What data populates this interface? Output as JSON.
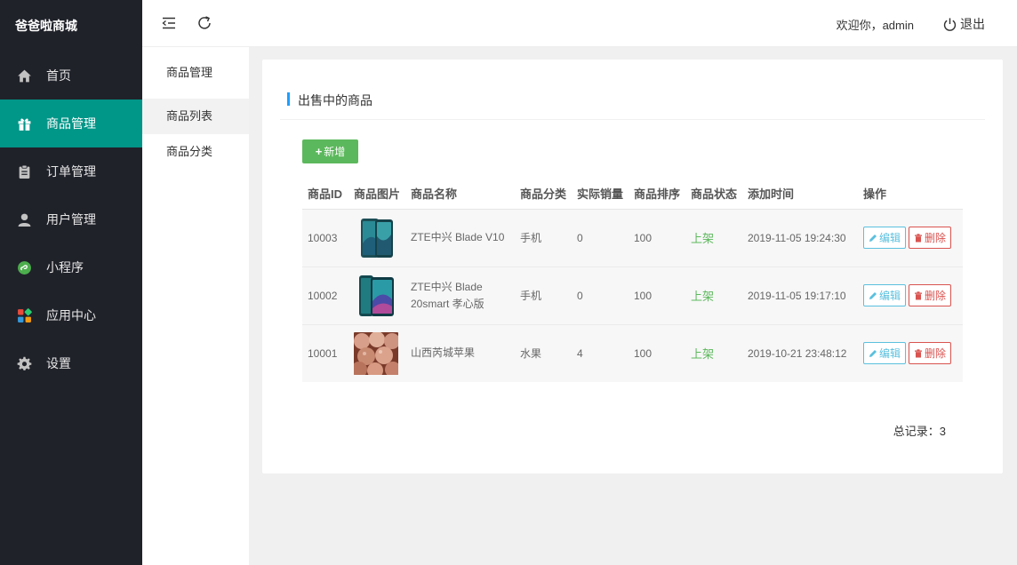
{
  "brand": "爸爸啦商城",
  "sidebar": {
    "items": [
      {
        "label": "首页",
        "icon": "home-icon"
      },
      {
        "label": "商品管理",
        "icon": "gift-icon"
      },
      {
        "label": "订单管理",
        "icon": "clipboard-icon"
      },
      {
        "label": "用户管理",
        "icon": "user-icon"
      },
      {
        "label": "小程序",
        "icon": "miniprogram-icon"
      },
      {
        "label": "应用中心",
        "icon": "apps-icon"
      },
      {
        "label": "设置",
        "icon": "gear-icon"
      }
    ],
    "active_index": 1
  },
  "header": {
    "welcome": "欢迎你，admin",
    "logout": "退出"
  },
  "subnav": {
    "title": "商品管理",
    "items": [
      {
        "label": "商品列表"
      },
      {
        "label": "商品分类"
      }
    ]
  },
  "panel": {
    "title": "出售中的商品",
    "add_label": "新增",
    "columns": [
      "商品ID",
      "商品图片",
      "商品名称",
      "商品分类",
      "实际销量",
      "商品排序",
      "商品状态",
      "添加时间",
      "操作"
    ],
    "rows": [
      {
        "id": "10003",
        "name": "ZTE中兴 Blade V10",
        "category": "手机",
        "sales": "0",
        "sort": "100",
        "status": "上架",
        "time": "2019-11-05 19:24:30",
        "edit": "编辑",
        "delete": "删除"
      },
      {
        "id": "10002",
        "name": "ZTE中兴 Blade 20smart 孝心版",
        "category": "手机",
        "sales": "0",
        "sort": "100",
        "status": "上架",
        "time": "2019-11-05 19:17:10",
        "edit": "编辑",
        "delete": "删除"
      },
      {
        "id": "10001",
        "name": "山西芮城苹果",
        "category": "水果",
        "sales": "4",
        "sort": "100",
        "status": "上架",
        "time": "2019-10-21 23:48:12",
        "edit": "编辑",
        "delete": "删除"
      }
    ],
    "total": "总记录：3"
  },
  "colors": {
    "sidebar_bg": "#20222a",
    "active_nav": "#009688",
    "status_on": "#5cb85c",
    "edit": "#5bc0de",
    "delete": "#d9534f"
  }
}
